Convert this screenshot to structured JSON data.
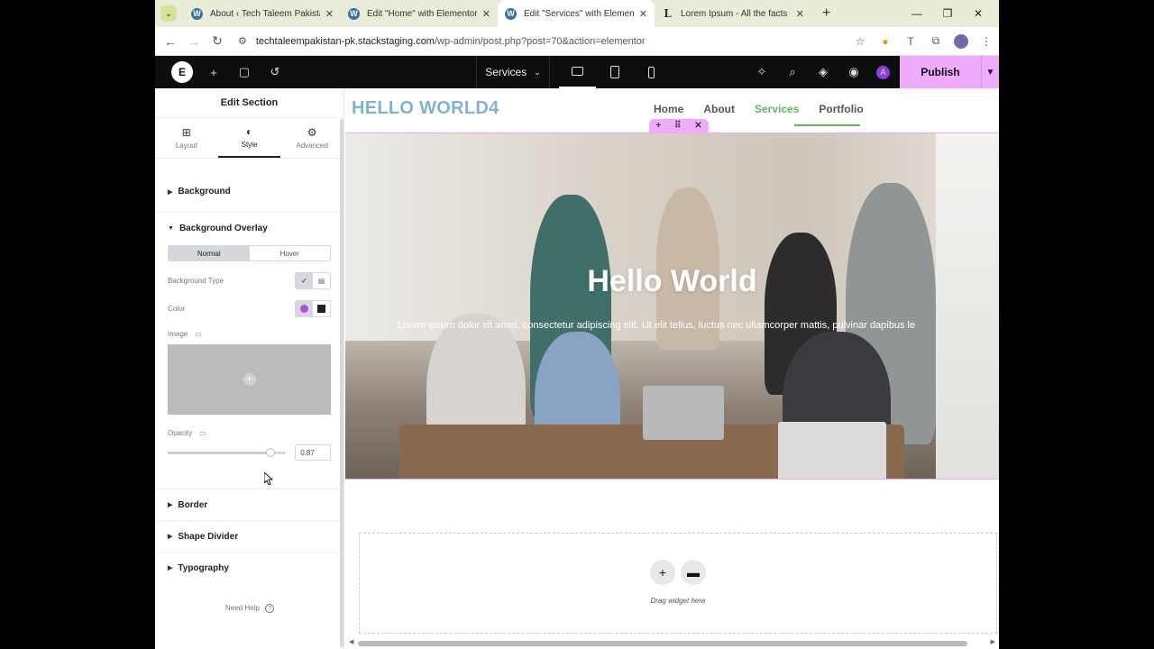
{
  "browser": {
    "tabs": [
      {
        "title": "About ‹ Tech Taleem Pakistan —",
        "active": false,
        "favicon": "wordpress-icon"
      },
      {
        "title": "Edit \"Home\" with Elementor",
        "active": false,
        "favicon": "wordpress-icon"
      },
      {
        "title": "Edit \"Services\" with Elementor",
        "active": true,
        "favicon": "wordpress-icon"
      },
      {
        "title": "Lorem Ipsum - All the facts - Lip",
        "active": false,
        "favicon": "lorem-icon"
      }
    ],
    "url_host": "techtaleempakistan-pk.stackstaging.com",
    "url_path": "/wp-admin/post.php?post=70&action=elementor"
  },
  "editor": {
    "page_name": "Services",
    "publish_label": "Publish",
    "avatar_letter": "A"
  },
  "panel": {
    "title": "Edit Section",
    "tabs": [
      "Layout",
      "Style",
      "Advanced"
    ],
    "background_label": "Background",
    "overlay_label": "Background Overlay",
    "state_normal": "Normal",
    "state_hover": "Hover",
    "bg_type_label": "Background Type",
    "color_label": "Color",
    "image_label": "Image",
    "opacity_label": "Opacity",
    "opacity_value": "0.87",
    "opacity_fraction": 0.87,
    "border_label": "Border",
    "shape_divider_label": "Shape Divider",
    "typography_label": "Typography",
    "need_help": "Need Help"
  },
  "site": {
    "title": "HELLO WORLD4",
    "nav": [
      "Home",
      "About",
      "Services",
      "Portfolio"
    ],
    "active_nav": "Services",
    "hero_title": "Hello World",
    "hero_text": "Lorem ipsum dolor sit amet, consectetur adipiscing elit. Ut elit tellus, luctus nec ullamcorper mattis, pulvinar dapibus le",
    "drop_text": "Drag widget here"
  },
  "colors": {
    "accent": "#f0abfc",
    "nav_active": "#5cb85c",
    "site_title": "#7fb3d5"
  }
}
